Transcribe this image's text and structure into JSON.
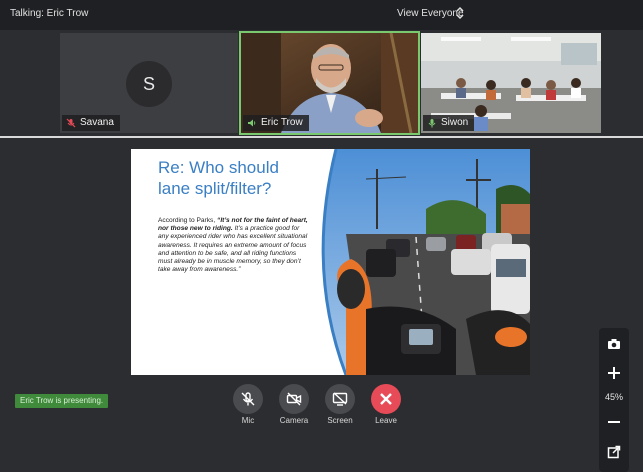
{
  "topbar": {
    "talking": "Talking: Eric Trow",
    "view_mode": "View Everyone"
  },
  "participants": [
    {
      "name": "Savana",
      "initial": "S",
      "mic": "muted",
      "video": "off"
    },
    {
      "name": "Eric Trow",
      "mic": "speaking",
      "video": "on",
      "active_speaker": true
    },
    {
      "name": "Siwon",
      "mic": "on",
      "video": "on"
    }
  ],
  "slide": {
    "title": "Re: Who should lane split/filter?",
    "body_intro": "According to Parks, ",
    "body_bold": "“It’s not for the faint of heart, nor those new to riding.",
    "body_rest": " It’s a practice good for any experienced rider who has excellent situational awareness. It requires an extreme amount of focus and attention to be safe, and all riding functions must already be in muscle memory, so they don’t take away from awareness.”"
  },
  "side_controls": {
    "zoom": "45%"
  },
  "status": {
    "presenting": "Eric Trow is presenting."
  },
  "controls": {
    "mic": "Mic",
    "camera": "Camera",
    "screen": "Screen",
    "leave": "Leave"
  },
  "colors": {
    "accent_green": "#7bc96f",
    "leave_red": "#e64b57",
    "slide_title_blue": "#3a7fc4"
  }
}
